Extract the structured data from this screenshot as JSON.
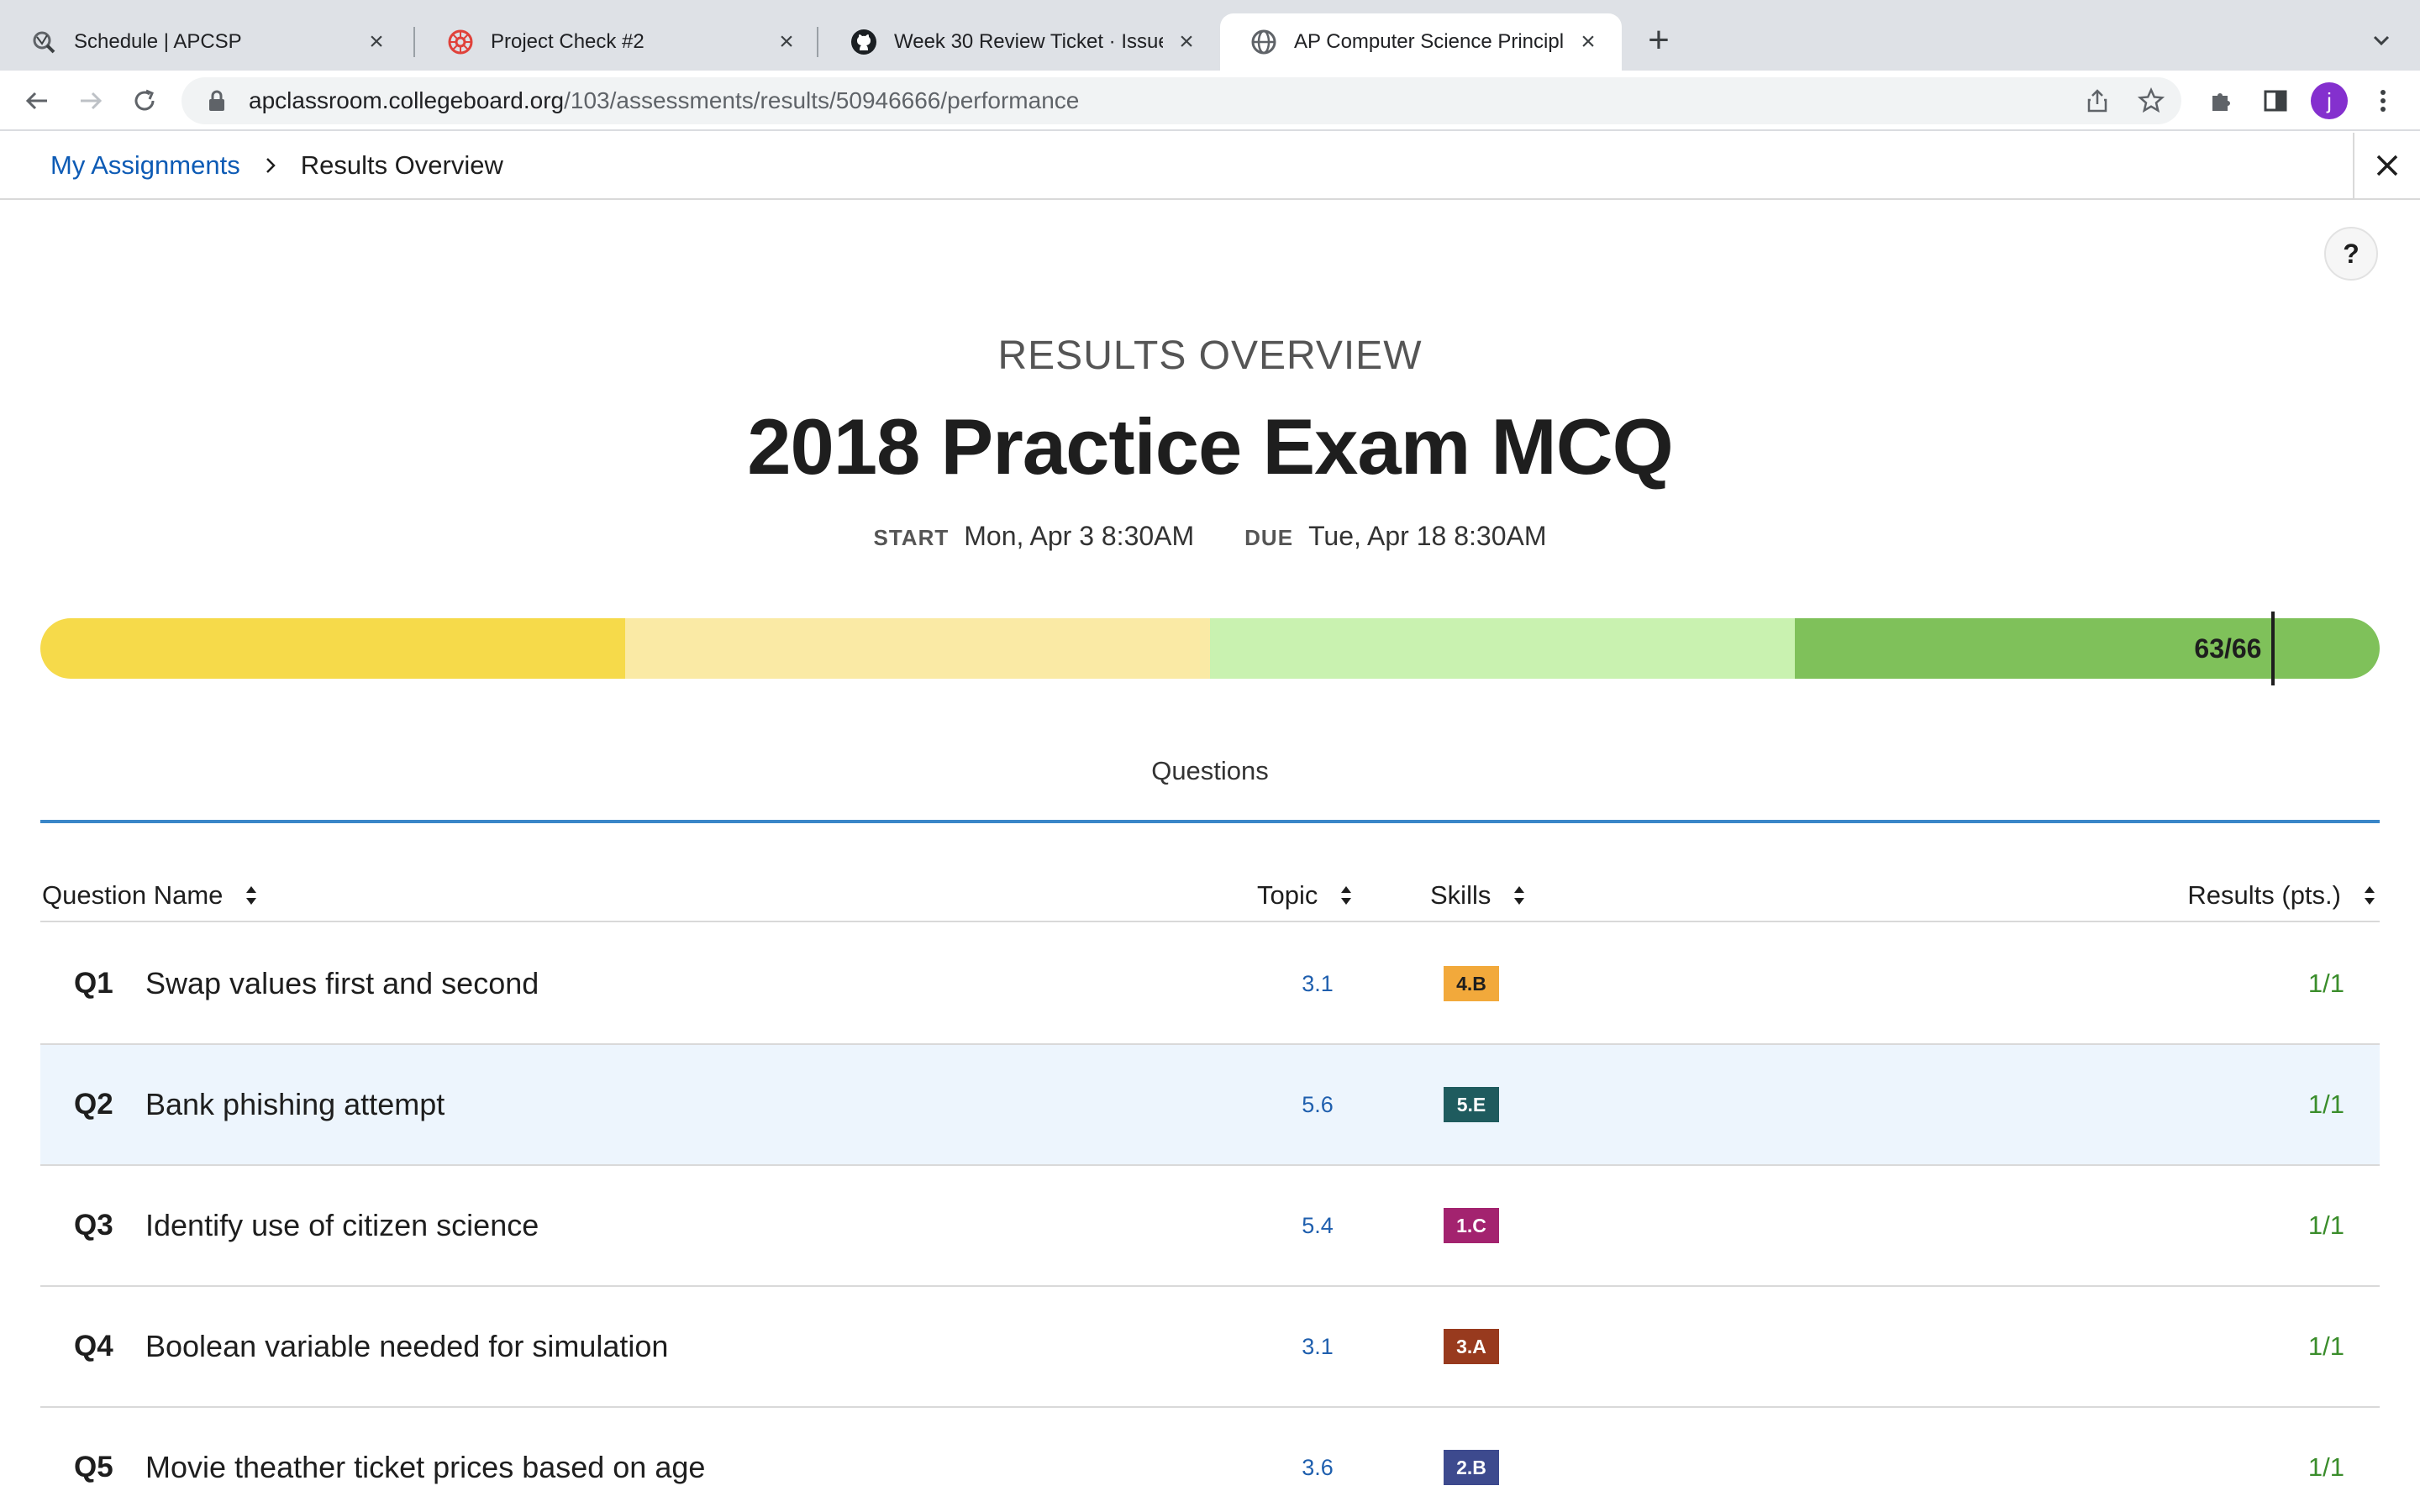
{
  "browser": {
    "tabs": [
      {
        "title": "Schedule | APCSP",
        "icon": "apcsp-favicon"
      },
      {
        "title": "Project Check #2",
        "icon": "red-gear-favicon"
      },
      {
        "title": "Week 30 Review Ticket · Issue",
        "icon": "github-icon"
      },
      {
        "title": "AP Computer Science Principle",
        "icon": "globe-icon",
        "active": true
      }
    ],
    "url_host": "apclassroom.collegeboard.org",
    "url_path": "/103/assessments/results/50946666/performance",
    "profile_initial": "j"
  },
  "breadcrumb": {
    "link": "My Assignments",
    "current": "Results Overview"
  },
  "help_label": "?",
  "header": {
    "eyebrow": "RESULTS OVERVIEW",
    "title": "2018 Practice Exam MCQ",
    "start_label": "START",
    "start_value": "Mon, Apr 3 8:30AM",
    "due_label": "DUE",
    "due_value": "Tue, Apr 18 8:30AM"
  },
  "score": {
    "label": "63/66",
    "earned": 63,
    "total": 66,
    "band_colors": [
      "#f6da4a",
      "#faeaa5",
      "#c9f2b0",
      "#7fc15a"
    ]
  },
  "questions_tab": "Questions",
  "table": {
    "headers": {
      "name": "Question Name",
      "topic": "Topic",
      "skills": "Skills",
      "results": "Results (pts.)"
    },
    "rows": [
      {
        "num": "Q1",
        "name": "Swap values first and second",
        "topic": "3.1",
        "skill": "4.B",
        "skill_color": "#f2a93b",
        "skill_text_color": "#1e1e1e",
        "points": "1/1"
      },
      {
        "num": "Q2",
        "name": "Bank phishing attempt",
        "topic": "5.6",
        "skill": "5.E",
        "skill_color": "#1f5b5e",
        "skill_text_color": "#ffffff",
        "points": "1/1"
      },
      {
        "num": "Q3",
        "name": "Identify use of citizen science",
        "topic": "5.4",
        "skill": "1.C",
        "skill_color": "#a3236f",
        "skill_text_color": "#ffffff",
        "points": "1/1"
      },
      {
        "num": "Q4",
        "name": "Boolean variable needed for simulation",
        "topic": "3.1",
        "skill": "3.A",
        "skill_color": "#983a1e",
        "skill_text_color": "#ffffff",
        "points": "1/1"
      },
      {
        "num": "Q5",
        "name": "Movie theather ticket prices based on age",
        "topic": "3.6",
        "skill": "2.B",
        "skill_color": "#3d4a8e",
        "skill_text_color": "#ffffff",
        "points": "1/1"
      }
    ]
  }
}
